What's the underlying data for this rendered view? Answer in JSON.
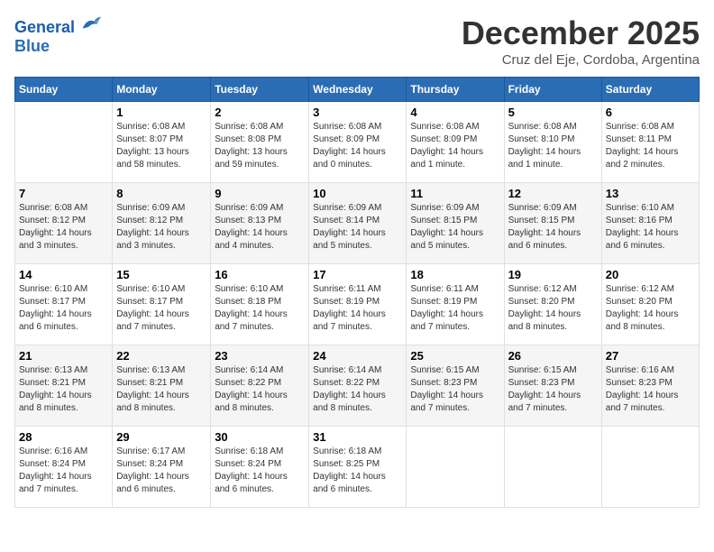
{
  "logo": {
    "line1": "General",
    "line2": "Blue"
  },
  "title": "December 2025",
  "subtitle": "Cruz del Eje, Cordoba, Argentina",
  "days_header": [
    "Sunday",
    "Monday",
    "Tuesday",
    "Wednesday",
    "Thursday",
    "Friday",
    "Saturday"
  ],
  "weeks": [
    [
      {
        "day": "",
        "sunrise": "",
        "sunset": "",
        "daylight": ""
      },
      {
        "day": "1",
        "sunrise": "Sunrise: 6:08 AM",
        "sunset": "Sunset: 8:07 PM",
        "daylight": "Daylight: 13 hours and 58 minutes."
      },
      {
        "day": "2",
        "sunrise": "Sunrise: 6:08 AM",
        "sunset": "Sunset: 8:08 PM",
        "daylight": "Daylight: 13 hours and 59 minutes."
      },
      {
        "day": "3",
        "sunrise": "Sunrise: 6:08 AM",
        "sunset": "Sunset: 8:09 PM",
        "daylight": "Daylight: 14 hours and 0 minutes."
      },
      {
        "day": "4",
        "sunrise": "Sunrise: 6:08 AM",
        "sunset": "Sunset: 8:09 PM",
        "daylight": "Daylight: 14 hours and 1 minute."
      },
      {
        "day": "5",
        "sunrise": "Sunrise: 6:08 AM",
        "sunset": "Sunset: 8:10 PM",
        "daylight": "Daylight: 14 hours and 1 minute."
      },
      {
        "day": "6",
        "sunrise": "Sunrise: 6:08 AM",
        "sunset": "Sunset: 8:11 PM",
        "daylight": "Daylight: 14 hours and 2 minutes."
      }
    ],
    [
      {
        "day": "7",
        "sunrise": "Sunrise: 6:08 AM",
        "sunset": "Sunset: 8:12 PM",
        "daylight": "Daylight: 14 hours and 3 minutes."
      },
      {
        "day": "8",
        "sunrise": "Sunrise: 6:09 AM",
        "sunset": "Sunset: 8:12 PM",
        "daylight": "Daylight: 14 hours and 3 minutes."
      },
      {
        "day": "9",
        "sunrise": "Sunrise: 6:09 AM",
        "sunset": "Sunset: 8:13 PM",
        "daylight": "Daylight: 14 hours and 4 minutes."
      },
      {
        "day": "10",
        "sunrise": "Sunrise: 6:09 AM",
        "sunset": "Sunset: 8:14 PM",
        "daylight": "Daylight: 14 hours and 5 minutes."
      },
      {
        "day": "11",
        "sunrise": "Sunrise: 6:09 AM",
        "sunset": "Sunset: 8:15 PM",
        "daylight": "Daylight: 14 hours and 5 minutes."
      },
      {
        "day": "12",
        "sunrise": "Sunrise: 6:09 AM",
        "sunset": "Sunset: 8:15 PM",
        "daylight": "Daylight: 14 hours and 6 minutes."
      },
      {
        "day": "13",
        "sunrise": "Sunrise: 6:10 AM",
        "sunset": "Sunset: 8:16 PM",
        "daylight": "Daylight: 14 hours and 6 minutes."
      }
    ],
    [
      {
        "day": "14",
        "sunrise": "Sunrise: 6:10 AM",
        "sunset": "Sunset: 8:17 PM",
        "daylight": "Daylight: 14 hours and 6 minutes."
      },
      {
        "day": "15",
        "sunrise": "Sunrise: 6:10 AM",
        "sunset": "Sunset: 8:17 PM",
        "daylight": "Daylight: 14 hours and 7 minutes."
      },
      {
        "day": "16",
        "sunrise": "Sunrise: 6:10 AM",
        "sunset": "Sunset: 8:18 PM",
        "daylight": "Daylight: 14 hours and 7 minutes."
      },
      {
        "day": "17",
        "sunrise": "Sunrise: 6:11 AM",
        "sunset": "Sunset: 8:19 PM",
        "daylight": "Daylight: 14 hours and 7 minutes."
      },
      {
        "day": "18",
        "sunrise": "Sunrise: 6:11 AM",
        "sunset": "Sunset: 8:19 PM",
        "daylight": "Daylight: 14 hours and 7 minutes."
      },
      {
        "day": "19",
        "sunrise": "Sunrise: 6:12 AM",
        "sunset": "Sunset: 8:20 PM",
        "daylight": "Daylight: 14 hours and 8 minutes."
      },
      {
        "day": "20",
        "sunrise": "Sunrise: 6:12 AM",
        "sunset": "Sunset: 8:20 PM",
        "daylight": "Daylight: 14 hours and 8 minutes."
      }
    ],
    [
      {
        "day": "21",
        "sunrise": "Sunrise: 6:13 AM",
        "sunset": "Sunset: 8:21 PM",
        "daylight": "Daylight: 14 hours and 8 minutes."
      },
      {
        "day": "22",
        "sunrise": "Sunrise: 6:13 AM",
        "sunset": "Sunset: 8:21 PM",
        "daylight": "Daylight: 14 hours and 8 minutes."
      },
      {
        "day": "23",
        "sunrise": "Sunrise: 6:14 AM",
        "sunset": "Sunset: 8:22 PM",
        "daylight": "Daylight: 14 hours and 8 minutes."
      },
      {
        "day": "24",
        "sunrise": "Sunrise: 6:14 AM",
        "sunset": "Sunset: 8:22 PM",
        "daylight": "Daylight: 14 hours and 8 minutes."
      },
      {
        "day": "25",
        "sunrise": "Sunrise: 6:15 AM",
        "sunset": "Sunset: 8:23 PM",
        "daylight": "Daylight: 14 hours and 7 minutes."
      },
      {
        "day": "26",
        "sunrise": "Sunrise: 6:15 AM",
        "sunset": "Sunset: 8:23 PM",
        "daylight": "Daylight: 14 hours and 7 minutes."
      },
      {
        "day": "27",
        "sunrise": "Sunrise: 6:16 AM",
        "sunset": "Sunset: 8:23 PM",
        "daylight": "Daylight: 14 hours and 7 minutes."
      }
    ],
    [
      {
        "day": "28",
        "sunrise": "Sunrise: 6:16 AM",
        "sunset": "Sunset: 8:24 PM",
        "daylight": "Daylight: 14 hours and 7 minutes."
      },
      {
        "day": "29",
        "sunrise": "Sunrise: 6:17 AM",
        "sunset": "Sunset: 8:24 PM",
        "daylight": "Daylight: 14 hours and 6 minutes."
      },
      {
        "day": "30",
        "sunrise": "Sunrise: 6:18 AM",
        "sunset": "Sunset: 8:24 PM",
        "daylight": "Daylight: 14 hours and 6 minutes."
      },
      {
        "day": "31",
        "sunrise": "Sunrise: 6:18 AM",
        "sunset": "Sunset: 8:25 PM",
        "daylight": "Daylight: 14 hours and 6 minutes."
      },
      {
        "day": "",
        "sunrise": "",
        "sunset": "",
        "daylight": ""
      },
      {
        "day": "",
        "sunrise": "",
        "sunset": "",
        "daylight": ""
      },
      {
        "day": "",
        "sunrise": "",
        "sunset": "",
        "daylight": ""
      }
    ]
  ]
}
